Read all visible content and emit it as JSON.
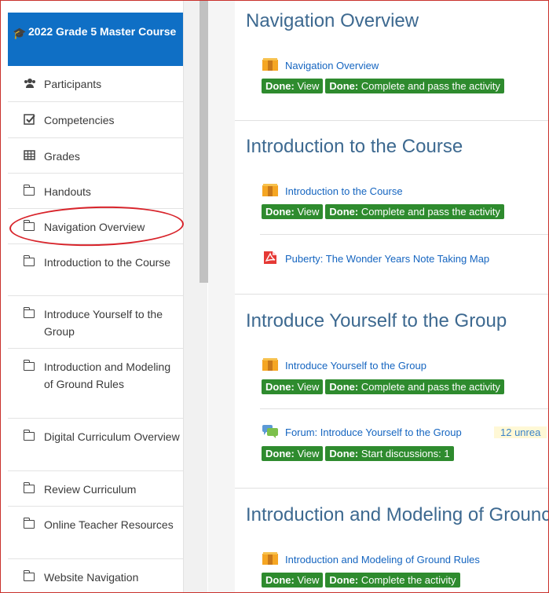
{
  "sidebar": {
    "course_title": "2022 Grade 5 Master Course",
    "items": [
      {
        "label": "Participants"
      },
      {
        "label": "Competencies"
      },
      {
        "label": "Grades"
      },
      {
        "label": "Handouts"
      },
      {
        "label": "Navigation Overview"
      },
      {
        "label": "Introduction to the Course"
      },
      {
        "label": "Introduce Yourself to the Group"
      },
      {
        "label": "Introduction and Modeling of Ground Rules"
      },
      {
        "label": "Digital Curriculum Overview"
      },
      {
        "label": "Review Curriculum"
      },
      {
        "label": "Online Teacher Resources"
      },
      {
        "label": "Website Navigation"
      }
    ]
  },
  "main": {
    "sections": [
      {
        "title": "Navigation Overview",
        "activities": [
          {
            "label": "Navigation Overview",
            "icon": "package-icon",
            "badges": [
              [
                "Done:",
                " View"
              ],
              [
                "Done:",
                " Complete and pass the activity"
              ]
            ]
          }
        ]
      },
      {
        "title": "Introduction to the Course",
        "activities": [
          {
            "label": "Introduction to the Course",
            "icon": "package-icon",
            "badges": [
              [
                "Done:",
                " View"
              ],
              [
                "Done:",
                " Complete and pass the activity"
              ]
            ]
          },
          {
            "label": "Puberty: The Wonder Years Note Taking Map",
            "icon": "pdf-icon"
          }
        ]
      },
      {
        "title": "Introduce Yourself to the Group",
        "activities": [
          {
            "label": "Introduce Yourself to the Group",
            "icon": "package-icon",
            "badges": [
              [
                "Done:",
                " View"
              ],
              [
                "Done:",
                " Complete and pass the activity"
              ]
            ]
          },
          {
            "label": "Forum: Introduce Yourself to the Group",
            "icon": "forum-icon",
            "unread": "12 unrea",
            "badges": [
              [
                "Done:",
                " View"
              ],
              [
                "Done:",
                " Start discussions: 1"
              ]
            ]
          }
        ]
      },
      {
        "title": "Introduction and Modeling of Grounc",
        "activities": [
          {
            "label": "Introduction and Modeling of Ground Rules",
            "icon": "package-icon",
            "badges": [
              [
                "Done:",
                " View"
              ],
              [
                "Done:",
                " Complete the activity"
              ]
            ]
          }
        ]
      }
    ]
  },
  "colors": {
    "accent": "#0f6fc5",
    "badge": "#2e8b2e",
    "section_title": "#3d6990",
    "annotation": "#d8232a"
  }
}
